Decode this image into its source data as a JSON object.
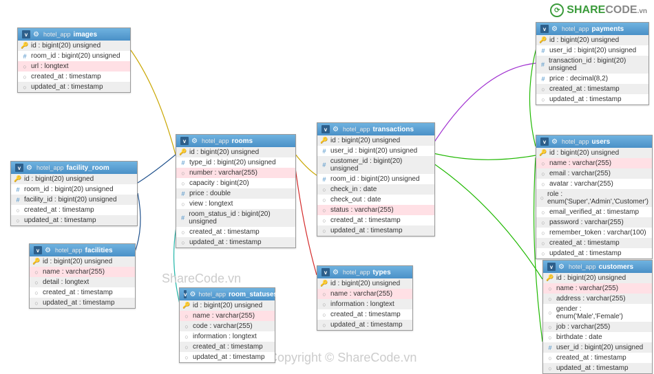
{
  "watermark1": "ShareCode.vn",
  "watermark2": "Copyright © ShareCode.vn",
  "logo": {
    "share": "SHARE",
    "code": "CODE",
    "vn": ".vn"
  },
  "db": "hotel_app",
  "tables": {
    "images": {
      "name": "images",
      "cols": [
        {
          "k": "key",
          "t": "id : bigint(20) unsigned"
        },
        {
          "k": "hash",
          "t": "room_id : bigint(20) unsigned"
        },
        {
          "k": "circ",
          "t": "url : longtext",
          "pink": true
        },
        {
          "k": "circ",
          "t": "created_at : timestamp"
        },
        {
          "k": "circ",
          "t": "updated_at : timestamp"
        }
      ]
    },
    "facility_room": {
      "name": "facility_room",
      "cols": [
        {
          "k": "key",
          "t": "id : bigint(20) unsigned"
        },
        {
          "k": "hash",
          "t": "room_id : bigint(20) unsigned"
        },
        {
          "k": "hash",
          "t": "facility_id : bigint(20) unsigned"
        },
        {
          "k": "circ",
          "t": "created_at : timestamp"
        },
        {
          "k": "circ",
          "t": "updated_at : timestamp"
        }
      ]
    },
    "facilities": {
      "name": "facilities",
      "cols": [
        {
          "k": "key",
          "t": "id : bigint(20) unsigned"
        },
        {
          "k": "circ",
          "t": "name : varchar(255)",
          "pink": true
        },
        {
          "k": "circ",
          "t": "detail : longtext"
        },
        {
          "k": "circ",
          "t": "created_at : timestamp"
        },
        {
          "k": "circ",
          "t": "updated_at : timestamp"
        }
      ]
    },
    "rooms": {
      "name": "rooms",
      "cols": [
        {
          "k": "key",
          "t": "id : bigint(20) unsigned"
        },
        {
          "k": "hash",
          "t": "type_id : bigint(20) unsigned"
        },
        {
          "k": "circ",
          "t": "number : varchar(255)",
          "pink": true
        },
        {
          "k": "circ",
          "t": "capacity : bigint(20)"
        },
        {
          "k": "hash",
          "t": "price : double"
        },
        {
          "k": "circ",
          "t": "view : longtext"
        },
        {
          "k": "hash",
          "t": "room_status_id : bigint(20) unsigned"
        },
        {
          "k": "circ",
          "t": "created_at : timestamp"
        },
        {
          "k": "circ",
          "t": "updated_at : timestamp"
        }
      ]
    },
    "room_statuses": {
      "name": "room_statuses",
      "cols": [
        {
          "k": "key",
          "t": "id : bigint(20) unsigned"
        },
        {
          "k": "circ",
          "t": "name : varchar(255)",
          "pink": true
        },
        {
          "k": "circ",
          "t": "code : varchar(255)"
        },
        {
          "k": "circ",
          "t": "information : longtext"
        },
        {
          "k": "circ",
          "t": "created_at : timestamp"
        },
        {
          "k": "circ",
          "t": "updated_at : timestamp"
        }
      ]
    },
    "transactions": {
      "name": "transactions",
      "cols": [
        {
          "k": "key",
          "t": "id : bigint(20) unsigned"
        },
        {
          "k": "hash",
          "t": "user_id : bigint(20) unsigned"
        },
        {
          "k": "hash",
          "t": "customer_id : bigint(20) unsigned"
        },
        {
          "k": "hash",
          "t": "room_id : bigint(20) unsigned"
        },
        {
          "k": "circ",
          "t": "check_in : date"
        },
        {
          "k": "circ",
          "t": "check_out : date"
        },
        {
          "k": "circ",
          "t": "status : varchar(255)",
          "pink": true
        },
        {
          "k": "circ",
          "t": "created_at : timestamp"
        },
        {
          "k": "circ",
          "t": "updated_at : timestamp"
        }
      ]
    },
    "types": {
      "name": "types",
      "cols": [
        {
          "k": "key",
          "t": "id : bigint(20) unsigned"
        },
        {
          "k": "circ",
          "t": "name : varchar(255)",
          "pink": true
        },
        {
          "k": "circ",
          "t": "information : longtext"
        },
        {
          "k": "circ",
          "t": "created_at : timestamp"
        },
        {
          "k": "circ",
          "t": "updated_at : timestamp"
        }
      ]
    },
    "payments": {
      "name": "payments",
      "cols": [
        {
          "k": "key",
          "t": "id : bigint(20) unsigned"
        },
        {
          "k": "hash",
          "t": "user_id : bigint(20) unsigned"
        },
        {
          "k": "hash",
          "t": "transaction_id : bigint(20) unsigned"
        },
        {
          "k": "hash",
          "t": "price : decimal(8,2)"
        },
        {
          "k": "circ",
          "t": "created_at : timestamp"
        },
        {
          "k": "circ",
          "t": "updated_at : timestamp"
        }
      ]
    },
    "users": {
      "name": "users",
      "cols": [
        {
          "k": "key",
          "t": "id : bigint(20) unsigned"
        },
        {
          "k": "circ",
          "t": "name : varchar(255)",
          "pink": true
        },
        {
          "k": "circ",
          "t": "email : varchar(255)"
        },
        {
          "k": "circ",
          "t": "avatar : varchar(255)"
        },
        {
          "k": "circ",
          "t": "role : enum('Super','Admin','Customer')"
        },
        {
          "k": "circ",
          "t": "email_verified_at : timestamp"
        },
        {
          "k": "circ",
          "t": "password : varchar(255)"
        },
        {
          "k": "circ",
          "t": "remember_token : varchar(100)"
        },
        {
          "k": "circ",
          "t": "created_at : timestamp"
        },
        {
          "k": "circ",
          "t": "updated_at : timestamp"
        }
      ]
    },
    "customers": {
      "name": "customers",
      "cols": [
        {
          "k": "key",
          "t": "id : bigint(20) unsigned"
        },
        {
          "k": "circ",
          "t": "name : varchar(255)",
          "pink": true
        },
        {
          "k": "circ",
          "t": "address : varchar(255)"
        },
        {
          "k": "circ",
          "t": "gender : enum('Male','Female')"
        },
        {
          "k": "circ",
          "t": "job : varchar(255)"
        },
        {
          "k": "circ",
          "t": "birthdate : date"
        },
        {
          "k": "hash",
          "t": "user_id : bigint(20) unsigned"
        },
        {
          "k": "circ",
          "t": "created_at : timestamp"
        },
        {
          "k": "circ",
          "t": "updated_at : timestamp"
        }
      ]
    }
  }
}
